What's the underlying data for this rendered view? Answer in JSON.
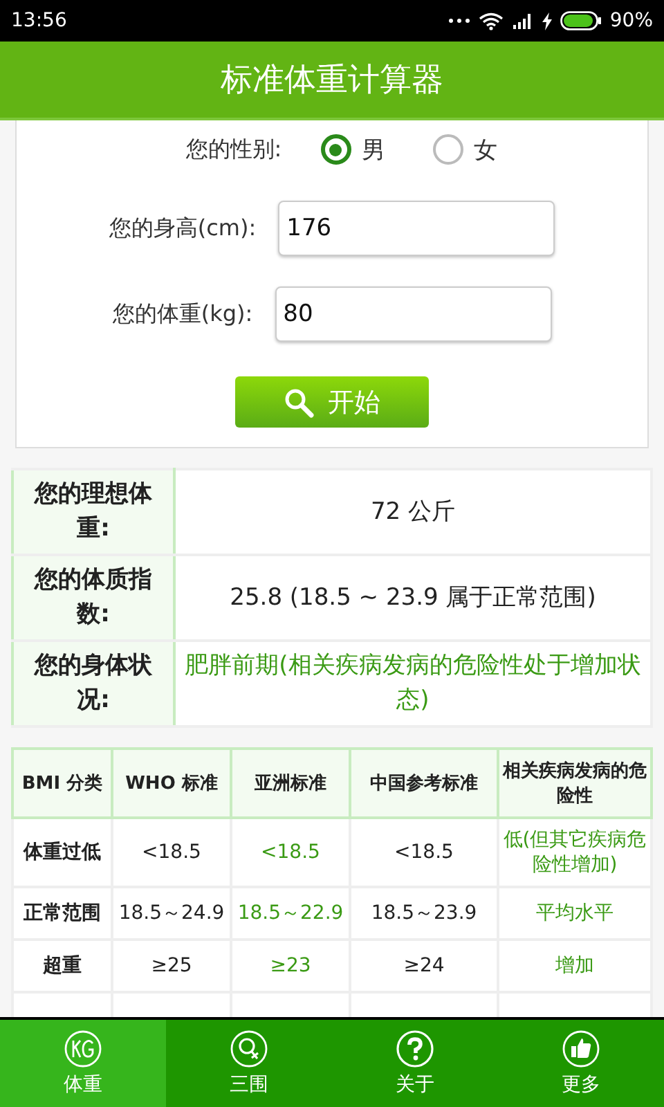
{
  "status_bar": {
    "time": "13:56",
    "battery_text": "90%"
  },
  "header": {
    "title": "标准体重计算器"
  },
  "form": {
    "gender_label": "您的性别:",
    "genders": [
      {
        "label": "男",
        "selected": true
      },
      {
        "label": "女",
        "selected": false
      }
    ],
    "height_label": "您的身高(cm):",
    "height_value": "176",
    "weight_label": "您的体重(kg):",
    "weight_value": "80",
    "button": "开始"
  },
  "results": [
    {
      "label": "您的理想体重:",
      "value": "72 公斤",
      "emphasis": false
    },
    {
      "label": "您的体质指数:",
      "value": "25.8 (18.5 ~ 23.9 属于正常范围)",
      "emphasis": false
    },
    {
      "label": "您的身体状况:",
      "value": "肥胖前期(相关疾病发病的危险性处于增加状态)",
      "emphasis": true
    }
  ],
  "bmi_table": {
    "columns": [
      "BMI 分类",
      "WHO 标准",
      "亚洲标准",
      "中国参考标准",
      "相关疾病发病的危险性"
    ],
    "rows": [
      [
        {
          "text": "体重过低",
          "emphasis": false
        },
        {
          "text": "<18.5",
          "emphasis": false
        },
        {
          "text": "<18.5",
          "emphasis": true
        },
        {
          "text": "<18.5",
          "emphasis": false
        },
        {
          "text": "低(但其它疾病危险性增加)",
          "emphasis": true
        }
      ],
      [
        {
          "text": "正常范围",
          "emphasis": false
        },
        {
          "text": "18.5～24.9",
          "emphasis": false
        },
        {
          "text": "18.5～22.9",
          "emphasis": true
        },
        {
          "text": "18.5～23.9",
          "emphasis": false
        },
        {
          "text": "平均水平",
          "emphasis": true
        }
      ],
      [
        {
          "text": "超重",
          "emphasis": false
        },
        {
          "text": "≥25",
          "emphasis": false
        },
        {
          "text": "≥23",
          "emphasis": true
        },
        {
          "text": "≥24",
          "emphasis": false
        },
        {
          "text": "增加",
          "emphasis": true
        }
      ]
    ]
  },
  "tabs": [
    {
      "label": "体重",
      "kind": "kg",
      "selected": true
    },
    {
      "label": "三围",
      "kind": "measure",
      "selected": false
    },
    {
      "label": "关于",
      "kind": "help",
      "selected": false
    },
    {
      "label": "更多",
      "kind": "thumb",
      "selected": false
    }
  ]
}
